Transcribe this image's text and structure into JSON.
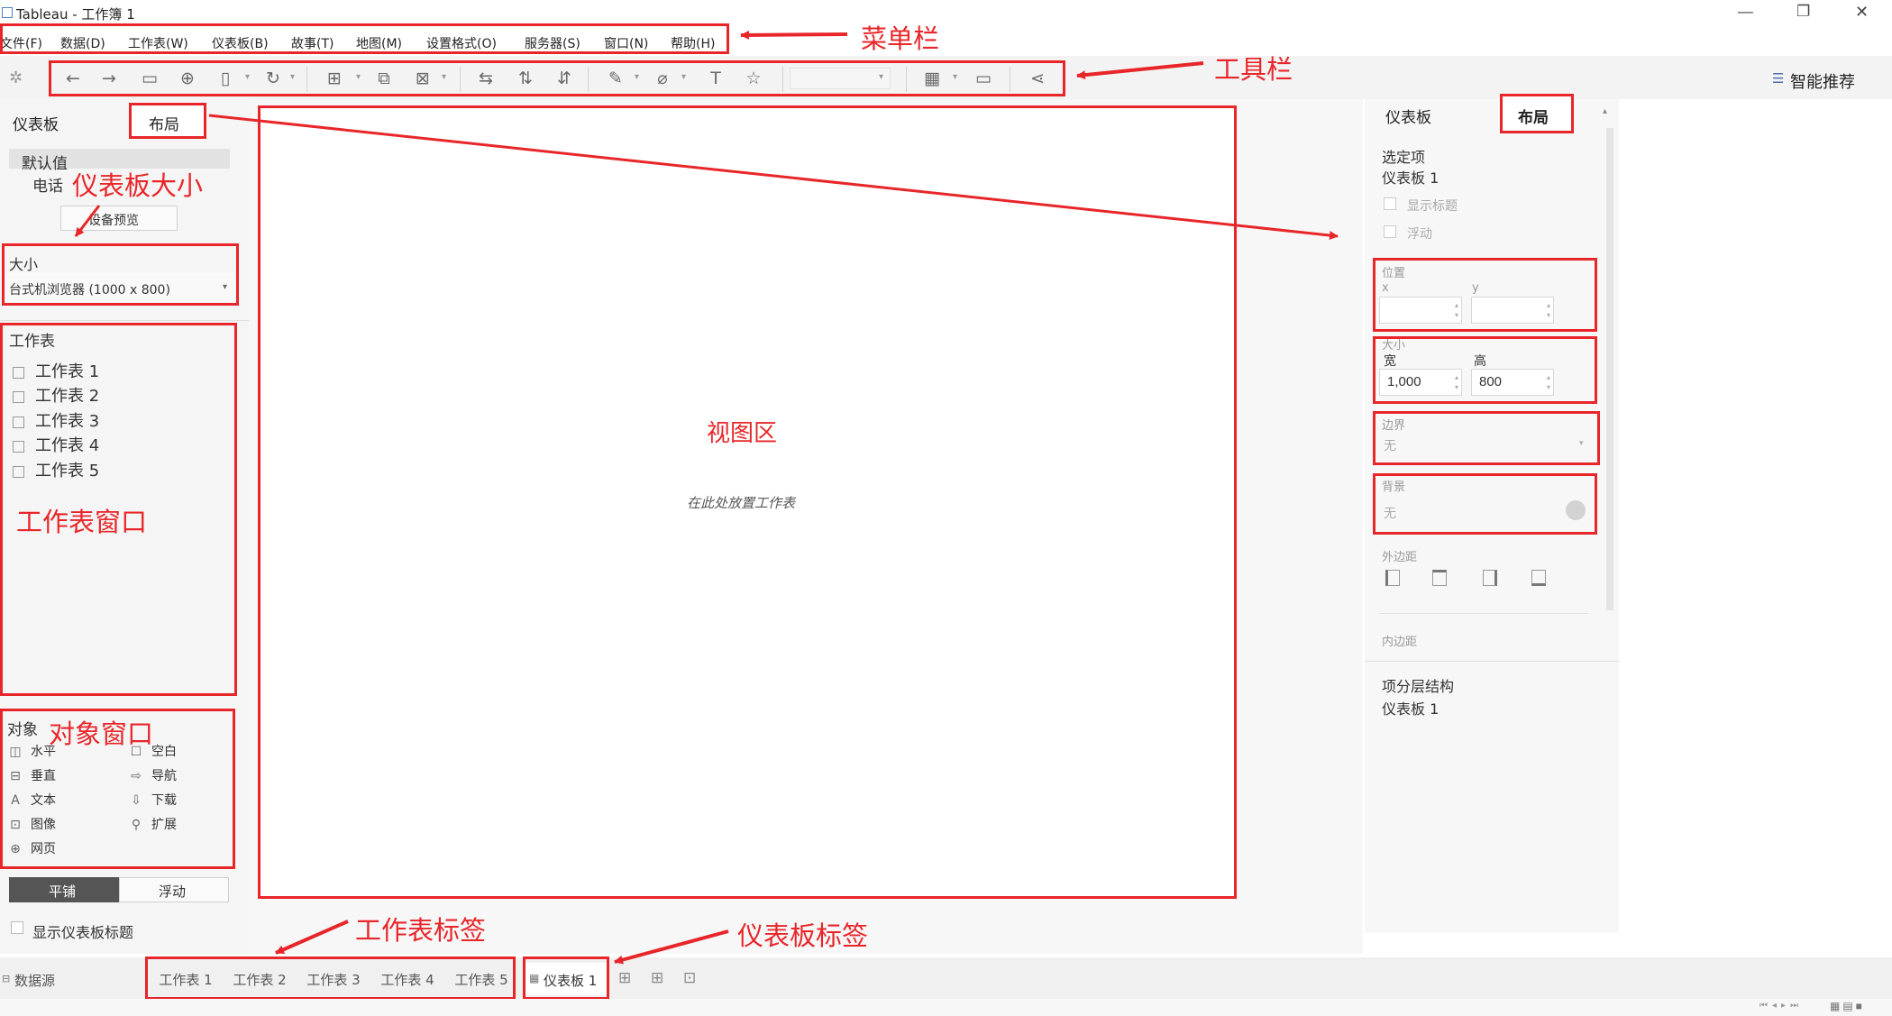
{
  "window": {
    "title": "Tableau - 工作簿 1",
    "controls": {
      "minimize": "—",
      "restore": "❐",
      "close": "✕"
    }
  },
  "menu": {
    "items": [
      "文件(F)",
      "数据(D)",
      "工作表(W)",
      "仪表板(B)",
      "故事(T)",
      "地图(M)",
      "设置格式(O)",
      "服务器(S)",
      "窗口(N)",
      "帮助(H)"
    ]
  },
  "toolbar": {
    "smart_recommend": "智能推荐"
  },
  "left_panel": {
    "tab_dashboard": "仪表板",
    "tab_layout": "布局",
    "device_default": "默认值",
    "device_phone": "电话",
    "device_preview_button": "设备预览",
    "size_label": "大小",
    "size_value": "台式机浏览器 (1000 x 800)",
    "sheets_title": "工作表",
    "sheets": [
      "工作表 1",
      "工作表 2",
      "工作表 3",
      "工作表 4",
      "工作表 5"
    ],
    "objects_title": "对象",
    "objects_left": [
      "水平",
      "垂直",
      "文本",
      "图像",
      "网页"
    ],
    "objects_right": [
      "空白",
      "导航",
      "下载",
      "扩展"
    ],
    "tiled_label": "平铺",
    "floating_label": "浮动",
    "show_title_label": "显示仪表板标题"
  },
  "canvas": {
    "drop_hint": "在此处放置工作表"
  },
  "right_panel": {
    "tab_dashboard": "仪表板",
    "tab_layout": "布局",
    "selected_label": "选定项",
    "selected_value": "仪表板 1",
    "show_title": "显示标题",
    "floating": "浮动",
    "position_label": "位置",
    "x_label": "x",
    "y_label": "y",
    "size_label": "大小",
    "width_label": "宽",
    "height_label": "高",
    "width_value": "1,000",
    "height_value": "800",
    "border_label": "边界",
    "border_value": "无",
    "background_label": "背景",
    "background_value": "无",
    "outer_padding_label": "外边距",
    "inner_padding_label": "内边距",
    "hierarchy_label": "项分层结构",
    "hierarchy_value": "仪表板 1"
  },
  "bottom_bar": {
    "datasource": "数据源",
    "sheet_tabs": [
      "工作表 1",
      "工作表 2",
      "工作表 3",
      "工作表 4",
      "工作表 5"
    ],
    "dashboard_tab": "仪表板 1"
  },
  "annotations": {
    "menu_bar": "菜单栏",
    "toolbar": "工具栏",
    "dashboard_size": "仪表板大小",
    "view_area": "视图区",
    "sheet_window": "工作表窗口",
    "object_window": "对象窗口",
    "sheet_tabs": "工作表标签",
    "dashboard_tabs": "仪表板标签"
  },
  "colors": {
    "annotation_red": "#e8262a",
    "panel_bg": "#f5f5f5",
    "accent_dark": "#555555"
  }
}
